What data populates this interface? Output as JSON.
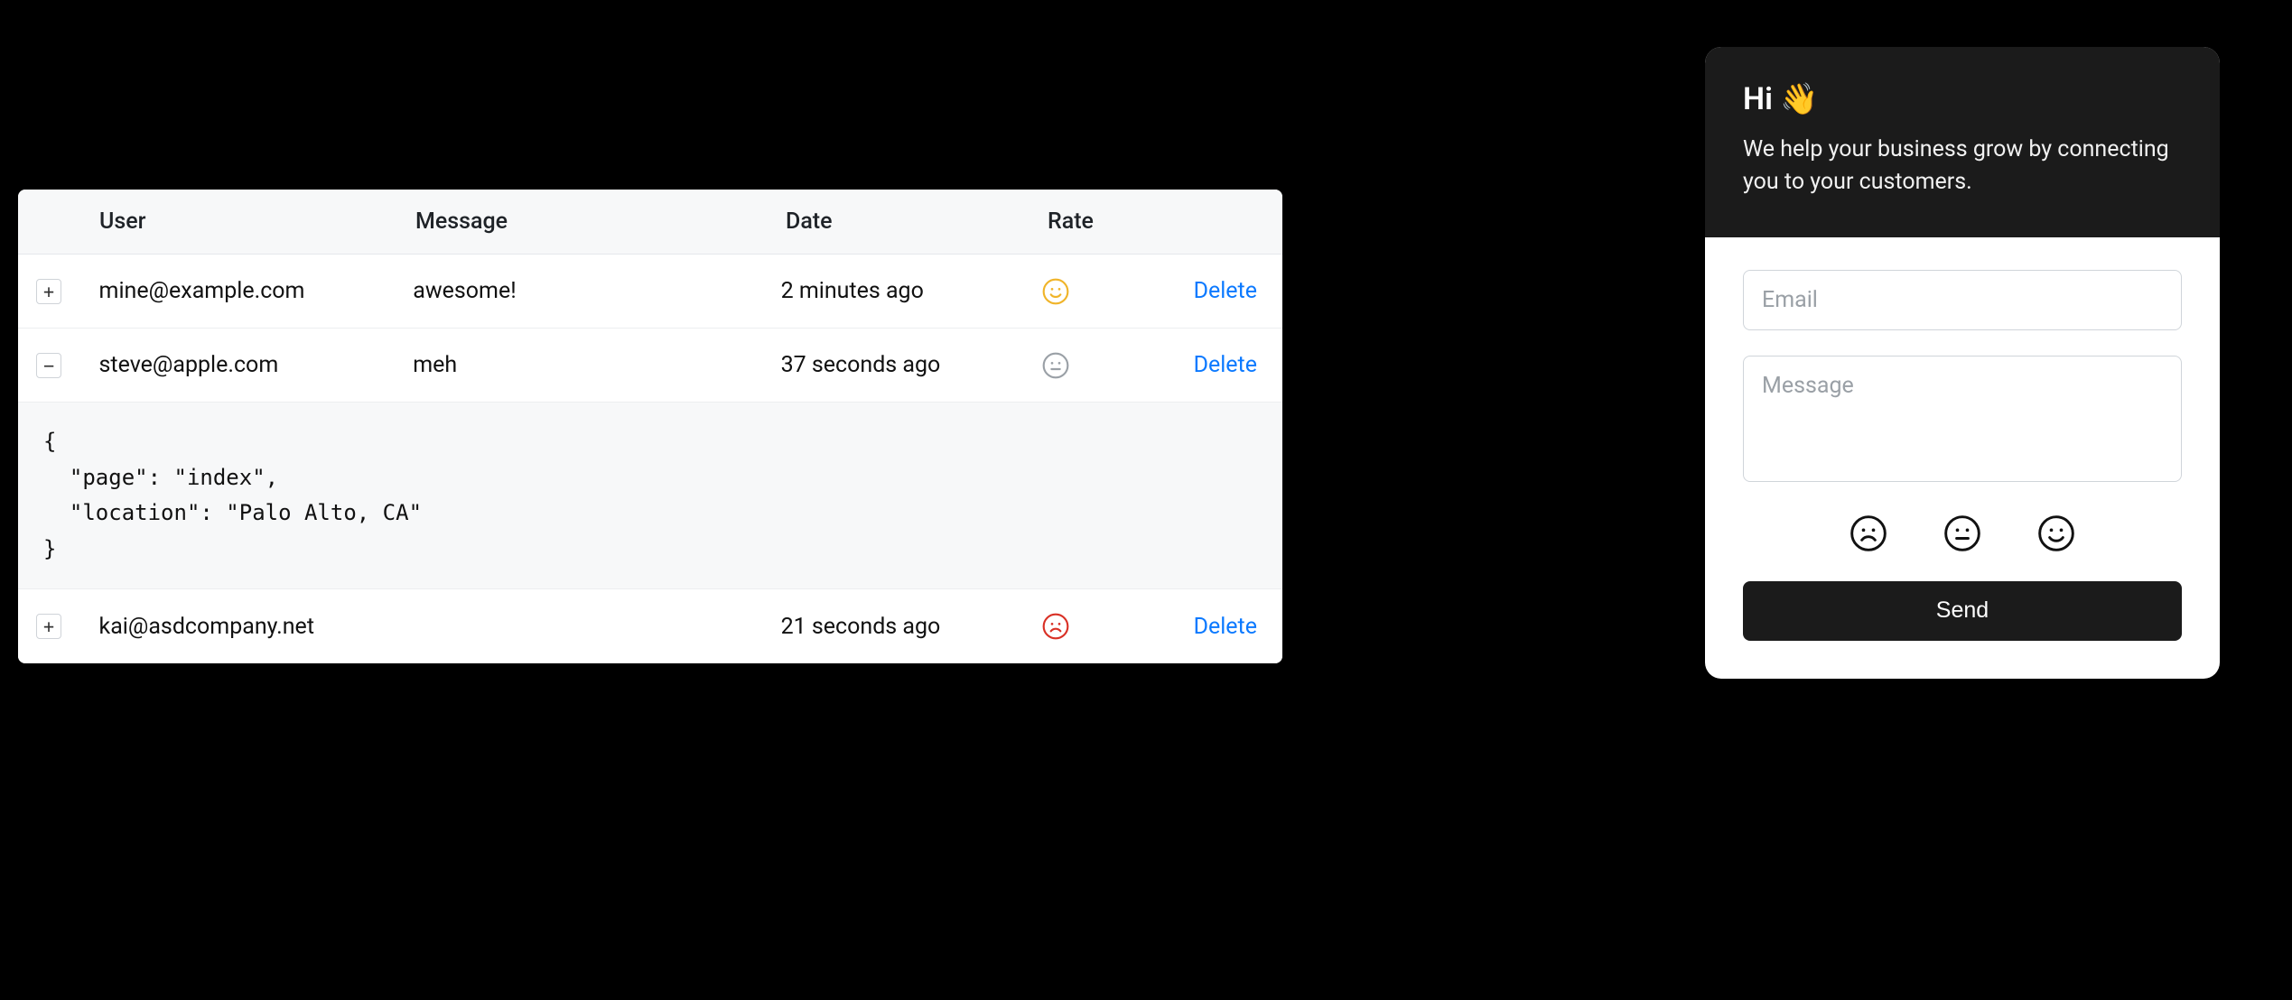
{
  "table": {
    "headers": {
      "user": "User",
      "message": "Message",
      "date": "Date",
      "rate": "Rate"
    },
    "delete_label": "Delete",
    "rows": [
      {
        "expand": "+",
        "user": "mine@example.com",
        "message": "awesome!",
        "date": "2 minutes ago",
        "rate": "happy"
      },
      {
        "expand": "−",
        "user": "steve@apple.com",
        "message": "meh",
        "date": "37 seconds ago",
        "rate": "neutral",
        "expanded_json": "{\n  \"page\": \"index\",\n  \"location\": \"Palo Alto, CA\"\n}"
      },
      {
        "expand": "+",
        "user": "kai@asdcompany.net",
        "message": "",
        "date": "21 seconds ago",
        "rate": "sad"
      }
    ]
  },
  "widget": {
    "title": "Hi 👋",
    "subtitle": "We help your business grow by connecting you to your customers.",
    "email_placeholder": "Email",
    "message_placeholder": "Message",
    "send_label": "Send"
  }
}
